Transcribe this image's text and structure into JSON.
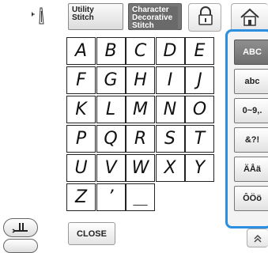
{
  "tabs": {
    "utility": [
      "Utility",
      "Stitch"
    ],
    "character": [
      "Character",
      "Decorative",
      "Stitch"
    ]
  },
  "keys": [
    [
      "A",
      "B",
      "C",
      "D",
      "E"
    ],
    [
      "F",
      "G",
      "H",
      "I",
      "J"
    ],
    [
      "K",
      "L",
      "M",
      "N",
      "O"
    ],
    [
      "P",
      "Q",
      "R",
      "S",
      "T"
    ],
    [
      "U",
      "V",
      "W",
      "X",
      "Y"
    ],
    [
      "Z",
      "’",
      "__"
    ]
  ],
  "sidebar": {
    "buttons": [
      {
        "label": "ABC",
        "active": true
      },
      {
        "label": "abc",
        "active": false
      },
      {
        "label": "0~9,.",
        "active": false
      },
      {
        "label": "&?!",
        "active": false
      },
      {
        "label": "ÄÅä",
        "active": false
      },
      {
        "label": "ÔÖö",
        "active": false
      }
    ]
  },
  "footer": {
    "close_label": "CLOSE"
  },
  "icons": {
    "needle": "needle-position-icon",
    "lock": "lock-icon",
    "home": "home-icon",
    "feed": "presser-foot-icon",
    "scroll": "chevron-up-double-icon"
  },
  "colors": {
    "accent_border": "#2a8fe0",
    "active_button": "#777777"
  }
}
